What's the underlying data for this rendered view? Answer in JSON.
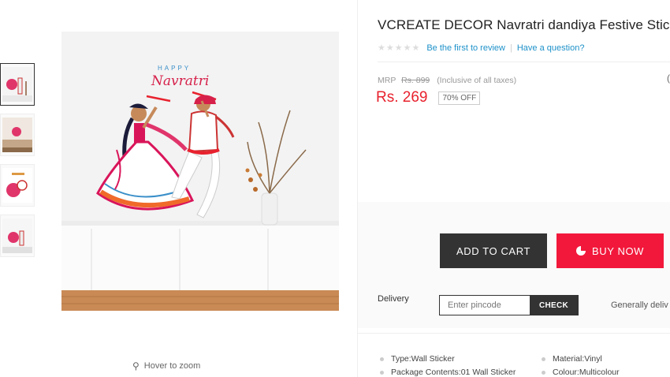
{
  "gallery": {
    "thumbnails": [
      "thumbnail-1",
      "thumbnail-2",
      "thumbnail-3",
      "thumbnail-4"
    ],
    "active_index": 0,
    "zoom_hint": "Hover to zoom",
    "zoom_icon": "magnifier-icon"
  },
  "product": {
    "title": "VCREATE DECOR Navratri dandiya Festive Stick",
    "rating_stars": 0,
    "review_link": "Be the first to review",
    "question_link": "Have a question?",
    "mrp_label": "MRP",
    "mrp_value": "Rs. 899",
    "tax_note": "(Inclusive of all taxes)",
    "price": "Rs. 269",
    "discount": "70% OFF",
    "edge_text": "("
  },
  "image": {
    "happy_text": "HAPPY",
    "navratri_text": "Navratri"
  },
  "actions": {
    "add_to_cart": "ADD TO CART",
    "buy_now": "BUY NOW"
  },
  "delivery": {
    "label": "Delivery",
    "pincode_placeholder": "Enter pincode",
    "check_label": "CHECK",
    "general_text": "Generally deliv"
  },
  "specs": [
    {
      "text": "Type:Wall Sticker"
    },
    {
      "text": "Material:Vinyl"
    },
    {
      "text": "Package Contents:01 Wall Sticker"
    },
    {
      "text": "Colour:Multicolour"
    }
  ],
  "colors": {
    "price_red": "#e8222e",
    "buy_red": "#f2183b",
    "link_blue": "#1d91c9",
    "dark_button": "#333333"
  }
}
